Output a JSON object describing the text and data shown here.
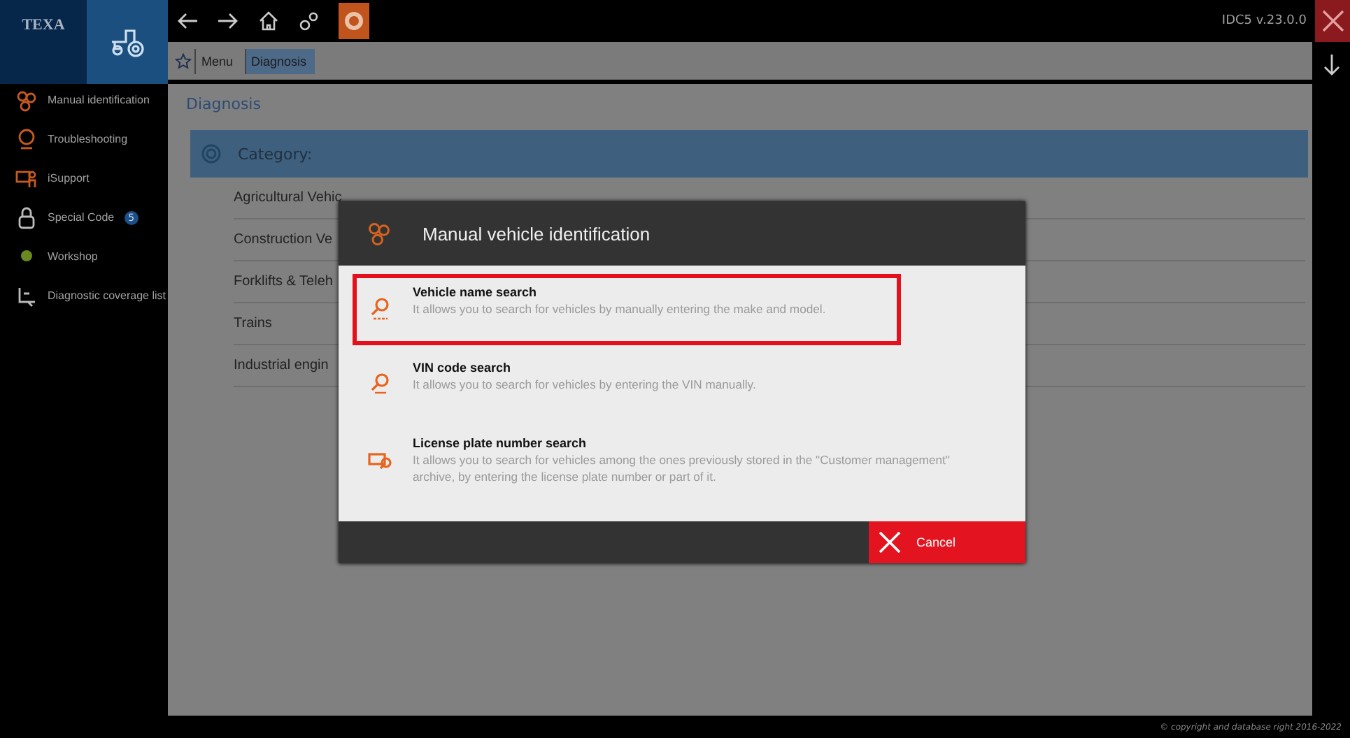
{
  "logo": {
    "brand": "TEXA"
  },
  "toolbar": {
    "version": "IDC5 v.23.0.0"
  },
  "breadcrumb": [
    {
      "label": "Menu",
      "selected": false
    },
    {
      "label": "Diagnosis",
      "selected": true
    }
  ],
  "sidebar": {
    "items": [
      {
        "label": "Manual identification"
      },
      {
        "label": "Troubleshooting"
      },
      {
        "label": "iSupport"
      },
      {
        "label": "Special Code",
        "badge": "5"
      },
      {
        "label": "Workshop"
      },
      {
        "label": "Diagnostic coverage list"
      }
    ]
  },
  "page": {
    "title": "Diagnosis",
    "category_header": "Category:",
    "categories": [
      "Agricultural Vehic",
      "Construction Ve",
      "Forklifts & Teleh",
      "Trains",
      "Industrial engin"
    ]
  },
  "dialog": {
    "title": "Manual vehicle identification",
    "options": [
      {
        "title": "Vehicle name search",
        "description": "It allows you to search for vehicles by manually entering the make and model.",
        "selected": true
      },
      {
        "title": "VIN code search",
        "description": "It allows you to search for vehicles by entering the VIN manually.",
        "selected": false
      },
      {
        "title": "License plate number search",
        "description": "It allows you to search for vehicles among the ones previously stored in the \"Customer management\" archive, by entering the license plate number or part of it.",
        "selected": false
      }
    ],
    "cancel": "Cancel"
  },
  "footer": {
    "copyright": "© copyright and database right 2016-2022"
  }
}
